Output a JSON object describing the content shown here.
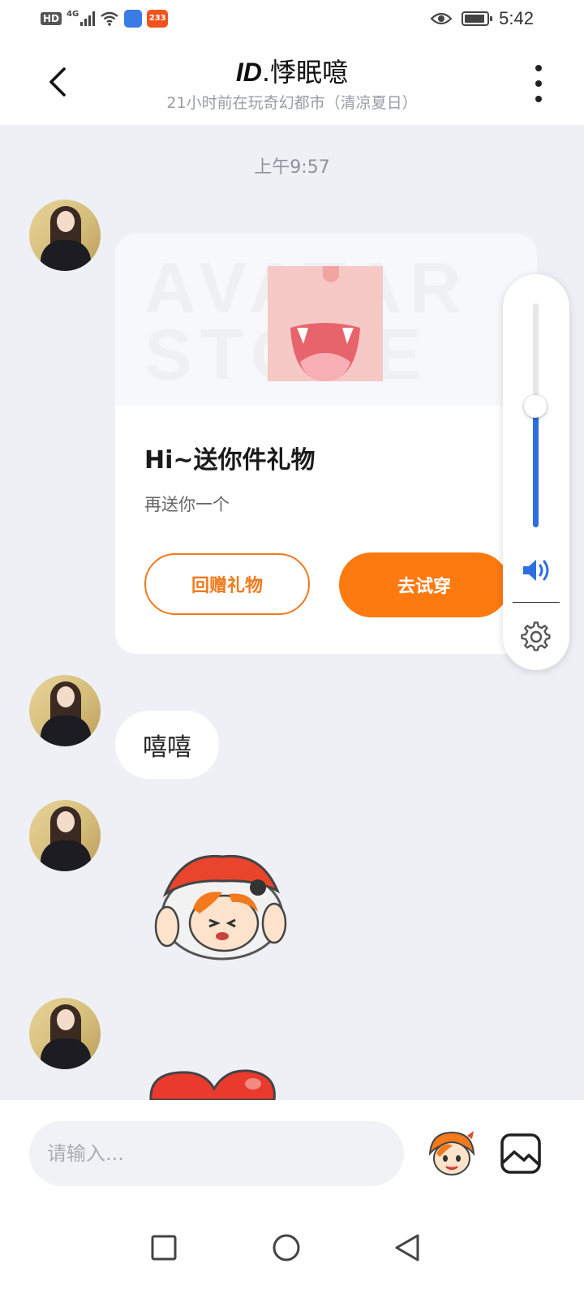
{
  "status_bar": {
    "network": "HD",
    "signal_type": "4G",
    "app_badge_2": "233",
    "time": "5:42"
  },
  "header": {
    "title_prefix": "ID",
    "title_name": ".悸眠噫",
    "subtitle": "21小时前在玩奇幻都市（清凉夏日）"
  },
  "chat": {
    "timestamp": "上午9:57",
    "gift_card": {
      "watermark": "AVATAR STORE",
      "title": "Hi~送你件礼物",
      "description": "再送你一个",
      "return_gift_label": "回赠礼物",
      "try_on_label": "去试穿"
    },
    "text_message": "嘻嘻"
  },
  "volume_panel": {
    "level": 0.54
  },
  "input_bar": {
    "placeholder": "请输入..."
  },
  "colors": {
    "accent_orange": "#fd7a10",
    "volume_blue": "#2d6fe0",
    "chat_background": "#eef0f6"
  },
  "icons": {
    "back": "chevron-left-icon",
    "more": "more-vertical-icon",
    "speaker": "speaker-icon",
    "settings": "gear-icon",
    "emoji": "mascot-emoji-icon",
    "image": "image-icon"
  }
}
